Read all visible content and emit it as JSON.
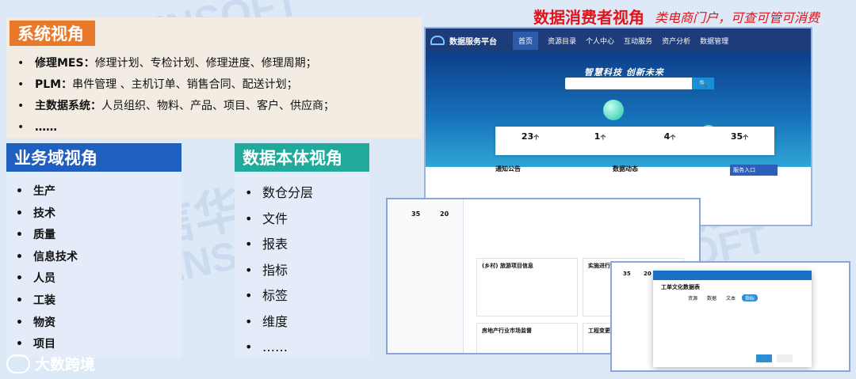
{
  "watermarks": [
    {
      "text": "ESENSOFT"
    },
    {
      "text": "亿信华辰"
    },
    {
      "text": "ESENSOFT"
    },
    {
      "text": "亿信华辰"
    },
    {
      "text": "ESENSOFT"
    }
  ],
  "header": {
    "title": "数据消费者视角",
    "subtitle": "类电商门户，可查可管可消费"
  },
  "system_view": {
    "title": "系统视角",
    "items": [
      {
        "key": "修理MES：",
        "value": "修理计划、专检计划、修理进度、修理周期；"
      },
      {
        "key": "PLM：",
        "value": "串件管理 、主机订单、销售合同、配送计划；"
      },
      {
        "key": "主数据系统：",
        "value": "人员组织、物料、产品、项目、客户、供应商；"
      },
      {
        "key": "……",
        "value": ""
      }
    ]
  },
  "business_view": {
    "title": "业务域视角",
    "items": [
      "生产",
      "技术",
      "质量",
      "信息技术",
      "人员",
      "工装",
      "物资",
      "项目"
    ]
  },
  "ontology_view": {
    "title": "数据本体视角",
    "items": [
      "数仓分层",
      "文件",
      "报表",
      "指标",
      "标签",
      "维度",
      "……"
    ]
  },
  "portal": {
    "name": "数据服务平台",
    "nav": [
      "首页",
      "资源目录",
      "个人中心",
      "互动服务",
      "资产分析",
      "数据管理"
    ],
    "banner": "智慧科技 创新未来",
    "search_button": "🔍",
    "stats": [
      {
        "value": "23",
        "unit": "个"
      },
      {
        "value": "1",
        "unit": "个"
      },
      {
        "value": "4",
        "unit": "个"
      },
      {
        "value": "35",
        "unit": "个"
      }
    ],
    "notice_title": "通知公告",
    "dynamics_title": "数据动态",
    "service_title": "服务入口"
  },
  "catalog": {
    "stat_a": "35",
    "stat_b": "20",
    "card1_title": "(乡村) 旅游项目信息",
    "card2_title": "房地产行业市场监督",
    "card3_title": "工程变更",
    "card4_title": "实施进行数字信息"
  },
  "dialog": {
    "title": "工单文化数据表",
    "stat_a": "35",
    "stat_b": "20",
    "tags": [
      "资源",
      "数据",
      "文本",
      "指标"
    ]
  },
  "logo": {
    "text": "大数跨境"
  },
  "colors": {
    "orange": "#e8792a",
    "blue": "#1f5fbf",
    "teal": "#21a99b",
    "red": "#e0151b",
    "portal_nav": "#1c3c7a"
  }
}
